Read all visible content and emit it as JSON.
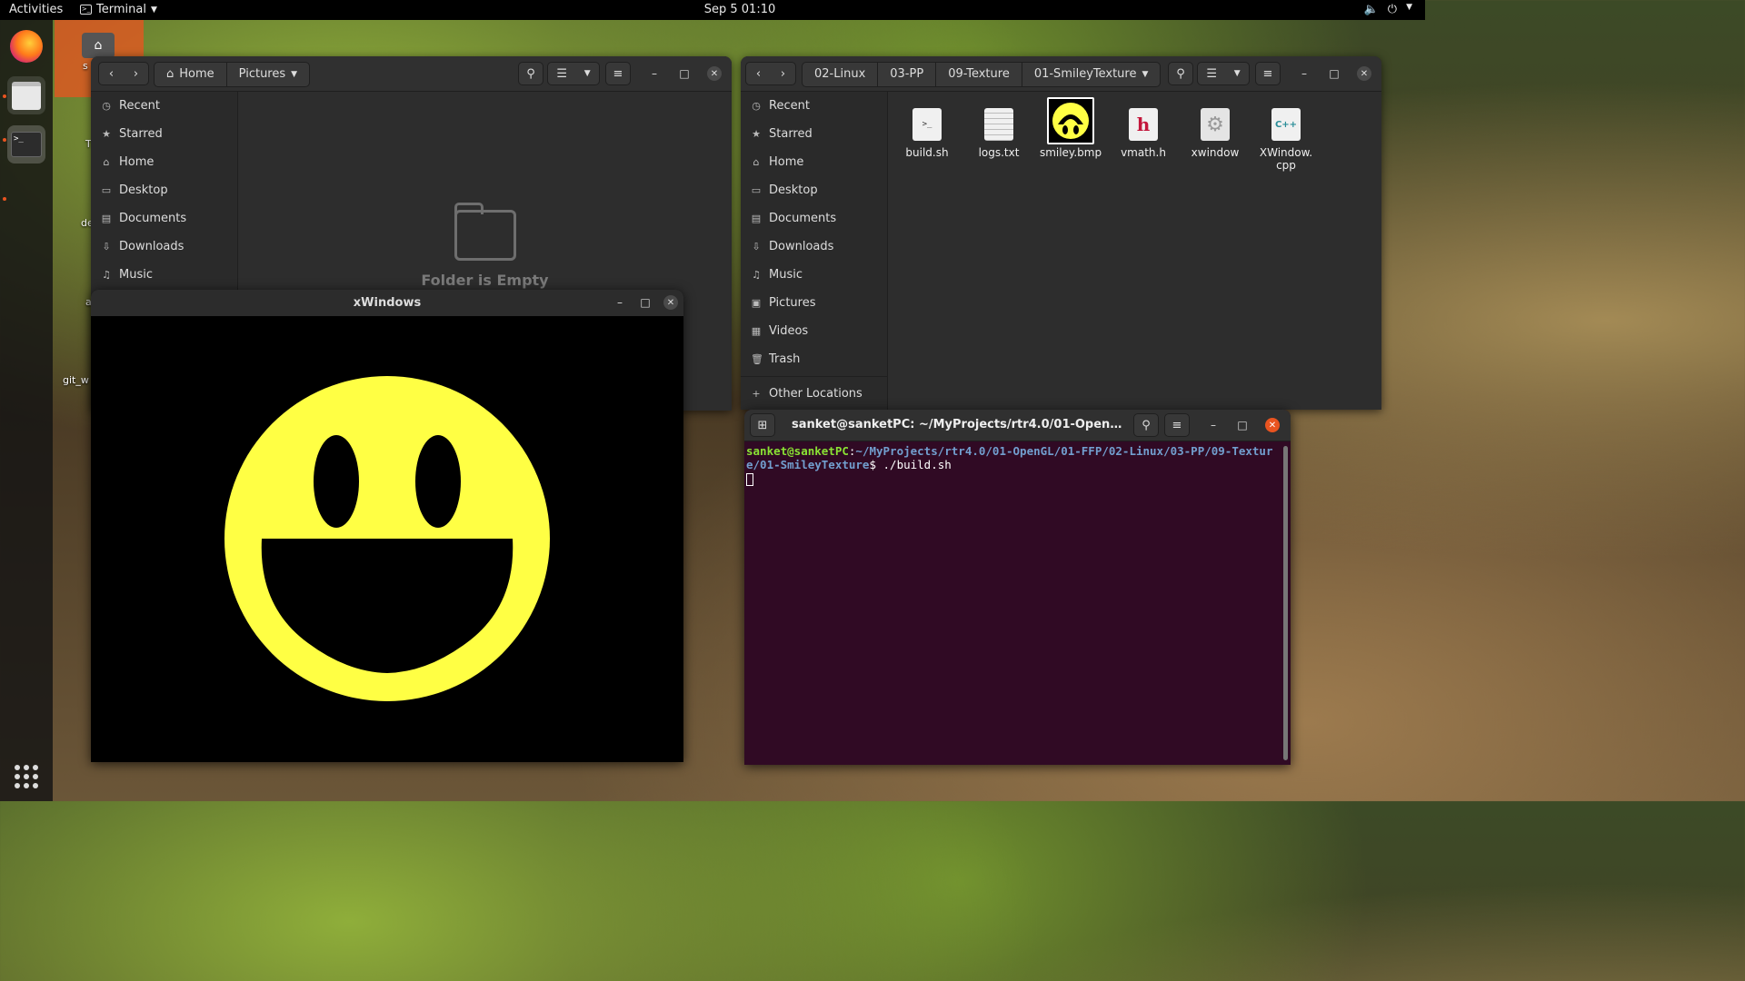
{
  "topbar": {
    "activities": "Activities",
    "app_name": "Terminal",
    "clock": "Sep 5  01:10"
  },
  "desktop": {
    "labels": [
      "s",
      "T",
      "de",
      "a",
      "git_w"
    ]
  },
  "files_left": {
    "breadcrumb": [
      "Home",
      "Pictures"
    ],
    "sidebar": [
      "Recent",
      "Starred",
      "Home",
      "Desktop",
      "Documents",
      "Downloads",
      "Music"
    ],
    "empty_text": "Folder is Empty"
  },
  "files_right": {
    "breadcrumb": [
      "02-Linux",
      "03-PP",
      "09-Texture",
      "01-SmileyTexture"
    ],
    "sidebar": [
      "Recent",
      "Starred",
      "Home",
      "Desktop",
      "Documents",
      "Downloads",
      "Music",
      "Pictures",
      "Videos",
      "Trash"
    ],
    "other_locations": "Other Locations",
    "files": [
      {
        "name": "build.sh",
        "icon": "script"
      },
      {
        "name": "logs.txt",
        "icon": "text"
      },
      {
        "name": "smiley.bmp",
        "icon": "image"
      },
      {
        "name": "vmath.h",
        "icon": "header"
      },
      {
        "name": "xwindow",
        "icon": "executable"
      },
      {
        "name": "XWindow.\ncpp",
        "icon": "cpp"
      }
    ]
  },
  "xwindow": {
    "title": "xWindows",
    "face_color": "#ffff44"
  },
  "terminal": {
    "title": "sanket@sanketPC: ~/MyProjects/rtr4.0/01-OpenGL/01-FFP/0...",
    "prompt_user": "sanket@sanketPC",
    "prompt_sep": ":",
    "prompt_path": "~/MyProjects/rtr4.0/01-OpenGL/01-FFP/02-Linux/03-PP/09-Texture/01-SmileyTexture",
    "prompt_symbol": "$ ",
    "command": "./build.sh",
    "bg_color": "#300a24"
  }
}
